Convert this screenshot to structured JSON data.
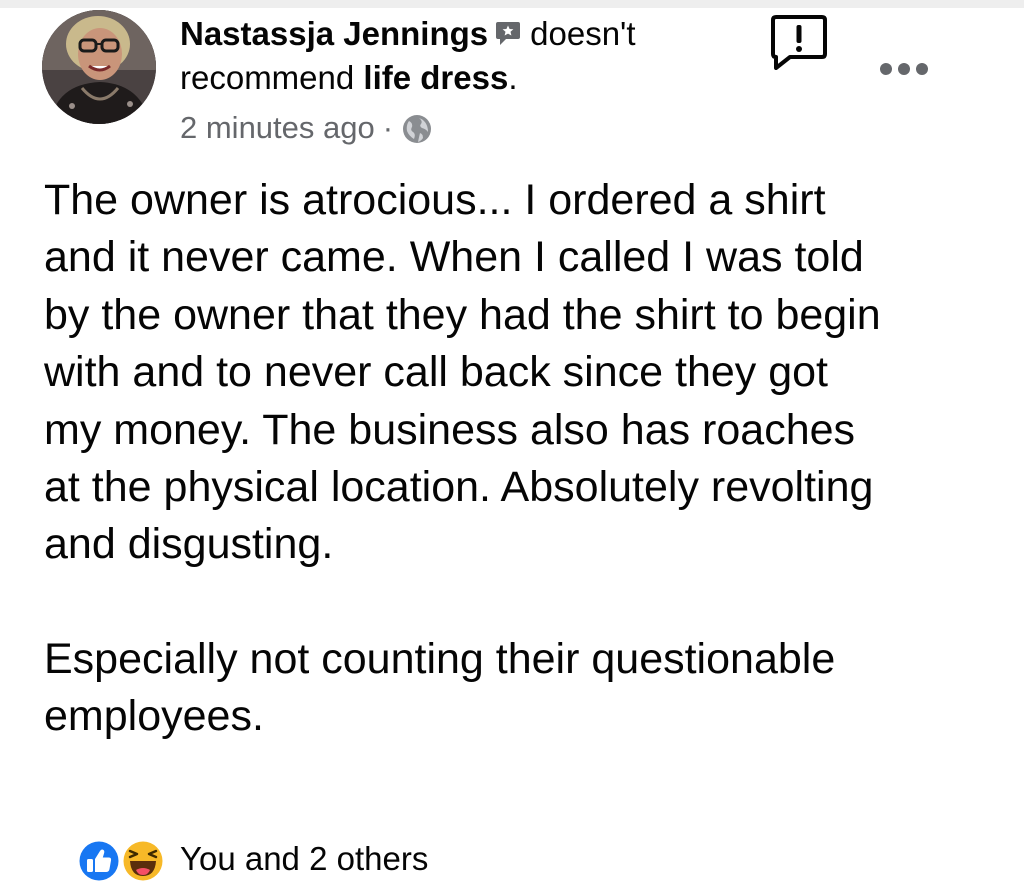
{
  "post": {
    "author": "Nastassja Jennings",
    "action_text": "doesn't",
    "action_line2": "recommend",
    "page_name": "life dress",
    "period": ".",
    "timestamp": "2 minutes ago",
    "separator": "·",
    "privacy_icon": "globe-icon",
    "report_icon": "report-flag-icon",
    "more_icon": "more-options-icon",
    "body_paragraphs": [
      "The owner is atrocious... I ordered a shirt\nand it never came. When I called I was told\nby the owner that they had the shirt to begin\nwith and to never call back since they got\nmy money. The business also has roaches\nat the physical location. Absolutely revolting\nand disgusting.",
      "Especially not counting their questionable\nemployees."
    ],
    "reactions": {
      "icons": [
        "like-icon",
        "haha-icon"
      ],
      "summary": "You and 2 others"
    }
  },
  "colors": {
    "text_primary": "#050505",
    "text_secondary": "#65676b",
    "like_blue": "#1877f2",
    "haha_yellow": "#f7b928"
  }
}
